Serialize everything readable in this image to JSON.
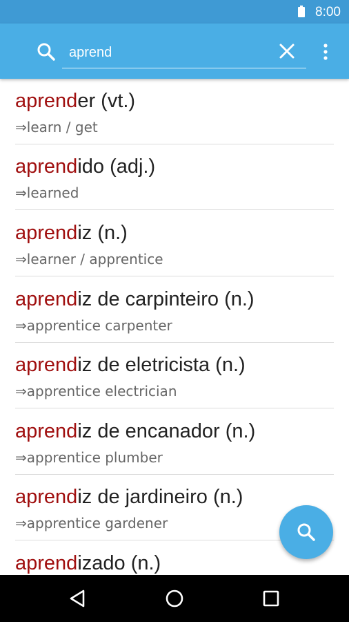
{
  "status_bar": {
    "time": "8:00",
    "battery_icon": "battery-full-icon"
  },
  "search": {
    "value": "aprend",
    "icon": "search-icon",
    "clear_icon": "close-icon",
    "menu_icon": "more-vert-icon"
  },
  "results": [
    {
      "highlight": "aprend",
      "rest": "er (vt.)",
      "translation": "⇒learn / get"
    },
    {
      "highlight": "aprend",
      "rest": "ido (adj.)",
      "translation": "⇒learned"
    },
    {
      "highlight": "aprend",
      "rest": "iz (n.)",
      "translation": "⇒learner / apprentice"
    },
    {
      "highlight": "aprend",
      "rest": "iz de carpinteiro (n.)",
      "translation": "⇒apprentice carpenter"
    },
    {
      "highlight": "aprend",
      "rest": "iz de eletricista (n.)",
      "translation": "⇒apprentice electrician"
    },
    {
      "highlight": "aprend",
      "rest": "iz de encanador (n.)",
      "translation": "⇒apprentice plumber"
    },
    {
      "highlight": "aprend",
      "rest": "iz de jardineiro (n.)",
      "translation": "⇒apprentice gardener"
    },
    {
      "highlight": "aprend",
      "rest": "izado (n.)",
      "translation": ""
    }
  ],
  "fab": {
    "icon": "search-icon"
  },
  "nav_bar": {
    "back_icon": "back-triangle-icon",
    "home_icon": "home-circle-icon",
    "recents_icon": "recents-square-icon"
  },
  "colors": {
    "app_bar": "#4aaee5",
    "status_bar": "#3f9ad4",
    "highlight": "#a00f0f"
  }
}
